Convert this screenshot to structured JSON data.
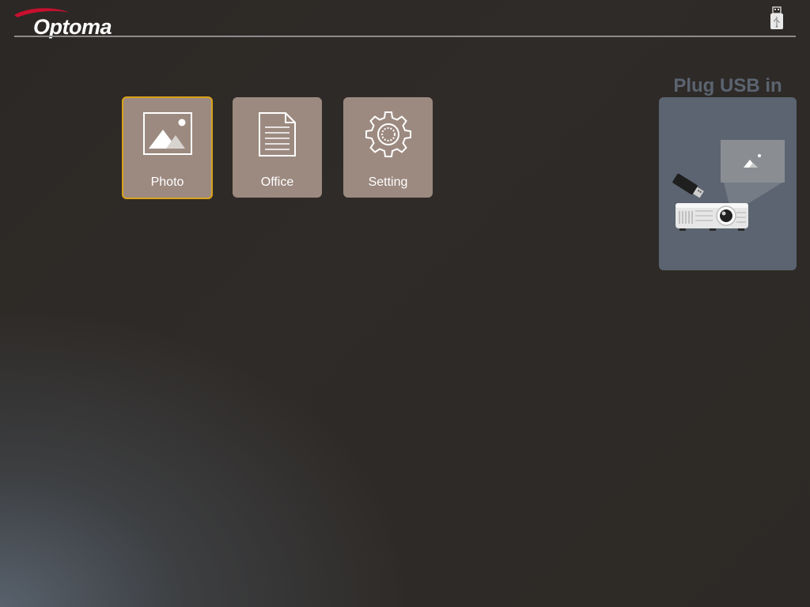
{
  "header": {
    "logo_text": "Optoma",
    "brand_color": "#c8102e",
    "usb_status_icon": "usb-stick-icon"
  },
  "tiles": [
    {
      "label": "Photo",
      "icon": "image-icon",
      "selected": true
    },
    {
      "label": "Office",
      "icon": "document-icon",
      "selected": false
    },
    {
      "label": "Setting",
      "icon": "gear-icon",
      "selected": false
    }
  ],
  "usb_panel": {
    "title": "Plug USB in",
    "illustration": "projector-with-usb-icon"
  },
  "colors": {
    "tile": "#9c8a80",
    "selection": "#d9a21b",
    "panel": "#5b6470"
  }
}
